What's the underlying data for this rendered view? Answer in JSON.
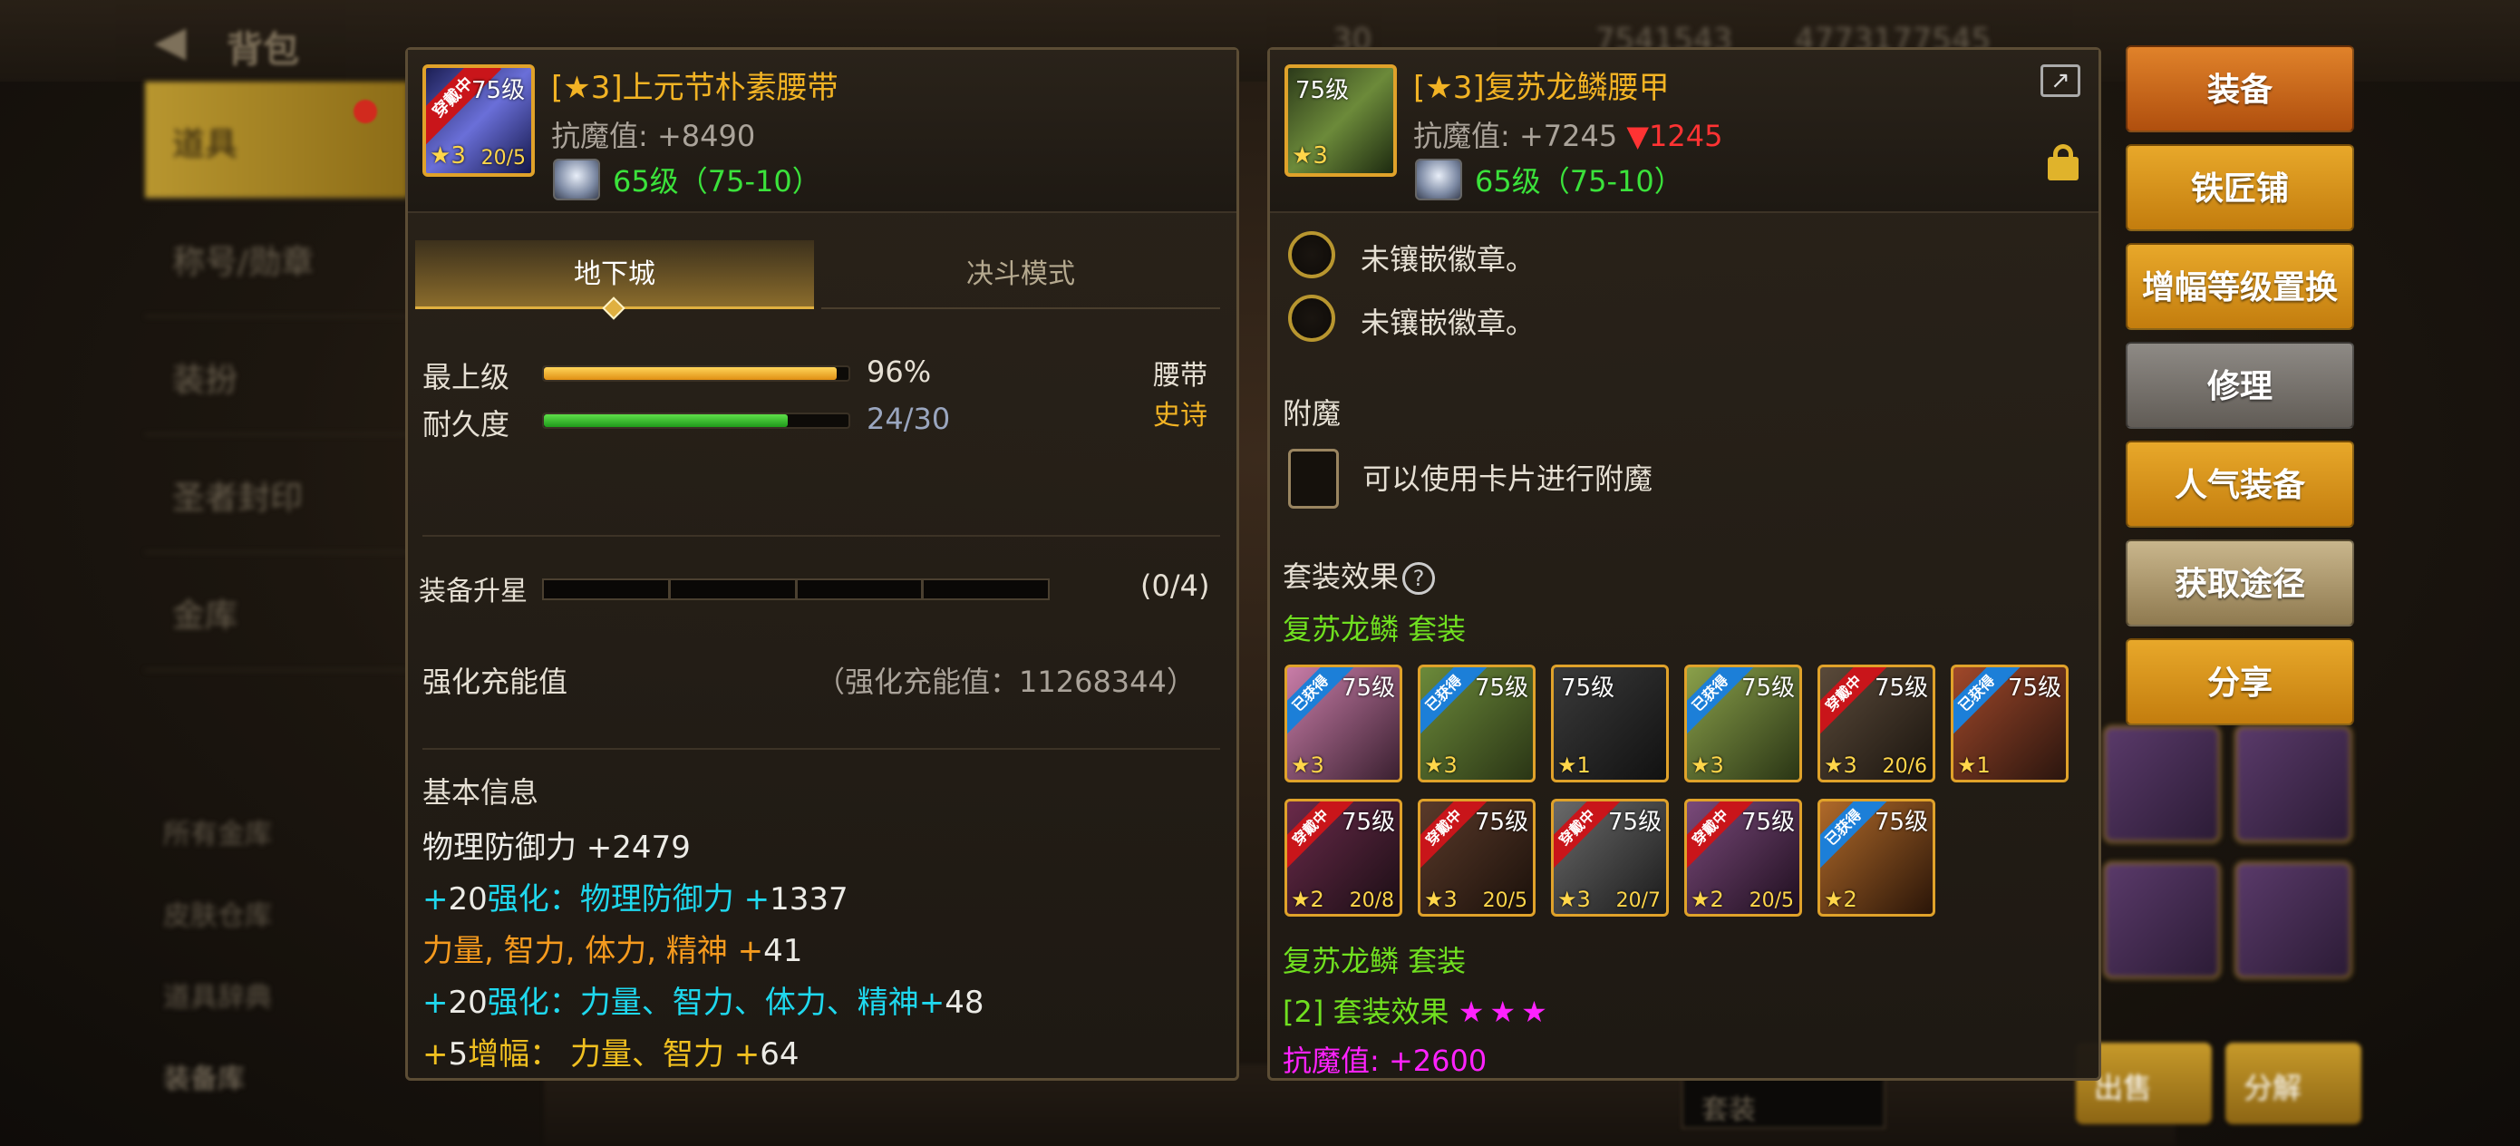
{
  "background": {
    "title": "背包",
    "top_stats": [
      "30",
      "7541543",
      "4773177545"
    ],
    "sidebar_items": [
      "道具",
      "称号/勋章",
      "装扮",
      "圣者封印",
      "金库"
    ],
    "sidebar_subitems": [
      "所有金库",
      "皮肤仓库",
      "道具辞典",
      "装备库"
    ],
    "bottom_buttons": [
      "出售",
      "分解"
    ],
    "dropdown_value": "套装"
  },
  "left_panel": {
    "icon": {
      "badge": "穿戴中",
      "level": "75级",
      "star": "3",
      "count": "20/5"
    },
    "name": "[★3]上元节朴素腰带",
    "stat": "抗魔值: +8490",
    "level_line": "65级（75-10）",
    "tabs": {
      "active": "地下城",
      "inactive": "决斗模式"
    },
    "bars": [
      {
        "label": "最上级",
        "value_text": "96%",
        "fraction": 0.96
      },
      {
        "label": "耐久度",
        "value_text": "24/30",
        "fraction": 0.8
      }
    ],
    "slot_type": "腰带",
    "rarity": "史诗",
    "star_upgrade": {
      "label": "装备升星",
      "progress": "(0/4)",
      "filled": 0,
      "total": 4
    },
    "enhance": {
      "label": "强化充能值",
      "value": "（强化充能值：11268344）"
    },
    "basic_info_title": "基本信息",
    "stats": [
      {
        "parts": [
          {
            "t": "物理防御力 +",
            "c": "white"
          },
          {
            "t": "2479",
            "c": "white"
          }
        ]
      },
      {
        "parts": [
          {
            "t": "+",
            "c": "cyan"
          },
          {
            "t": "20",
            "c": "white"
          },
          {
            "t": "强化：物理防御力 +",
            "c": "cyan"
          },
          {
            "t": "1337",
            "c": "white"
          }
        ]
      },
      {
        "parts": [
          {
            "t": "力量, 智力, 体力, 精神 +",
            "c": "orange"
          },
          {
            "t": "41",
            "c": "white"
          }
        ]
      },
      {
        "parts": [
          {
            "t": "+",
            "c": "cyan"
          },
          {
            "t": "20",
            "c": "white"
          },
          {
            "t": "强化：力量、智力、体力、精神+",
            "c": "cyan"
          },
          {
            "t": "48",
            "c": "white"
          }
        ]
      },
      {
        "parts": [
          {
            "t": " +",
            "c": "gold"
          },
          {
            "t": "5",
            "c": "white"
          },
          {
            "t": "增幅：  力量、智力 +",
            "c": "gold"
          },
          {
            "t": "64",
            "c": "white"
          }
        ]
      }
    ]
  },
  "right_panel": {
    "icon": {
      "level": "75级",
      "star": "3"
    },
    "name": "[★3]复苏龙鳞腰甲",
    "stat_prefix": "抗魔值: +7245 ",
    "stat_drop": "▼1245",
    "level_line": "65级（75-10）",
    "sockets": [
      "未镶嵌徽章。",
      "未镶嵌徽章。"
    ],
    "enchant_title": "附魔",
    "enchant_text": "可以使用卡片进行附魔",
    "set_title": "套装效果",
    "help_icon": "?",
    "set_name_1": "复苏龙鳞  套装",
    "set_items": [
      {
        "badge": "已获得",
        "badge_color": "blue",
        "level": "75级",
        "star": "3",
        "count": "",
        "colors": [
          "#c97da8",
          "#3a2030"
        ]
      },
      {
        "badge": "已获得",
        "badge_color": "blue",
        "level": "75级",
        "star": "3",
        "count": "",
        "colors": [
          "#6c8a3a",
          "#2a3515"
        ]
      },
      {
        "badge": "",
        "badge_color": "",
        "level": "75级",
        "star": "1",
        "count": "",
        "colors": [
          "#3a3a3a",
          "#111111"
        ]
      },
      {
        "badge": "已获得",
        "badge_color": "blue",
        "level": "75级",
        "star": "3",
        "count": "",
        "colors": [
          "#8aa04a",
          "#2a3515"
        ]
      },
      {
        "badge": "穿戴中",
        "badge_color": "red",
        "level": "75级",
        "star": "3",
        "count": "20/6",
        "colors": [
          "#5a4a3a",
          "#1a140e"
        ]
      },
      {
        "badge": "已获得",
        "badge_color": "blue",
        "level": "75级",
        "star": "1",
        "count": "",
        "colors": [
          "#a0482a",
          "#2a150e"
        ]
      },
      {
        "badge": "穿戴中",
        "badge_color": "red",
        "level": "75级",
        "star": "2",
        "count": "20/8",
        "colors": [
          "#6a2a4a",
          "#1a0e14"
        ]
      },
      {
        "badge": "穿戴中",
        "badge_color": "red",
        "level": "75级",
        "star": "3",
        "count": "20/5",
        "colors": [
          "#5a3a2a",
          "#1a100a"
        ]
      },
      {
        "badge": "穿戴中",
        "badge_color": "red",
        "level": "75级",
        "star": "3",
        "count": "20/7",
        "colors": [
          "#6a6a6a",
          "#1a1a1a"
        ]
      },
      {
        "badge": "穿戴中",
        "badge_color": "red",
        "level": "75级",
        "star": "2",
        "count": "20/5",
        "colors": [
          "#7a4a7a",
          "#1e0e1e"
        ]
      },
      {
        "badge": "已获得",
        "badge_color": "blue",
        "level": "75级",
        "star": "2",
        "count": "",
        "colors": [
          "#b06a2a",
          "#2a1508"
        ]
      }
    ],
    "set_name_2": "复苏龙鳞  套装",
    "set_effect": "[2] 套装效果 ",
    "set_effect_stars": "★★★",
    "set_bonus": "抗魔值:  +2600"
  },
  "buttons": [
    {
      "label": "装备",
      "style": "orange"
    },
    {
      "label": "铁匠铺",
      "style": "gold"
    },
    {
      "label": "增幅等级置换",
      "style": "gold"
    },
    {
      "label": "修理",
      "style": "gray"
    },
    {
      "label": "人气装备",
      "style": "gold"
    },
    {
      "label": "获取途径",
      "style": "tan"
    },
    {
      "label": "分享",
      "style": "gold"
    }
  ]
}
